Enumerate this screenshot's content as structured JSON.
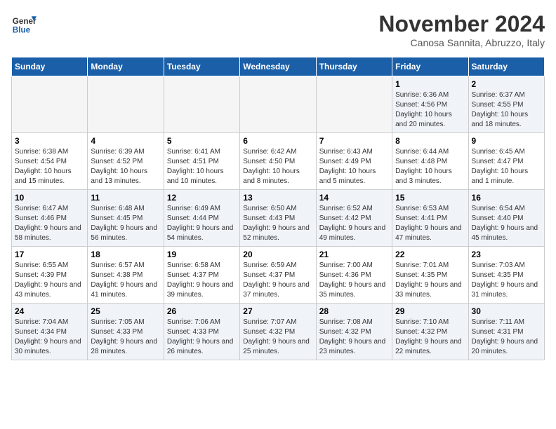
{
  "header": {
    "logo_line1": "General",
    "logo_line2": "Blue",
    "month": "November 2024",
    "location": "Canosa Sannita, Abruzzo, Italy"
  },
  "weekdays": [
    "Sunday",
    "Monday",
    "Tuesday",
    "Wednesday",
    "Thursday",
    "Friday",
    "Saturday"
  ],
  "weeks": [
    [
      {
        "day": "",
        "info": ""
      },
      {
        "day": "",
        "info": ""
      },
      {
        "day": "",
        "info": ""
      },
      {
        "day": "",
        "info": ""
      },
      {
        "day": "",
        "info": ""
      },
      {
        "day": "1",
        "info": "Sunrise: 6:36 AM\nSunset: 4:56 PM\nDaylight: 10 hours and 20 minutes."
      },
      {
        "day": "2",
        "info": "Sunrise: 6:37 AM\nSunset: 4:55 PM\nDaylight: 10 hours and 18 minutes."
      }
    ],
    [
      {
        "day": "3",
        "info": "Sunrise: 6:38 AM\nSunset: 4:54 PM\nDaylight: 10 hours and 15 minutes."
      },
      {
        "day": "4",
        "info": "Sunrise: 6:39 AM\nSunset: 4:52 PM\nDaylight: 10 hours and 13 minutes."
      },
      {
        "day": "5",
        "info": "Sunrise: 6:41 AM\nSunset: 4:51 PM\nDaylight: 10 hours and 10 minutes."
      },
      {
        "day": "6",
        "info": "Sunrise: 6:42 AM\nSunset: 4:50 PM\nDaylight: 10 hours and 8 minutes."
      },
      {
        "day": "7",
        "info": "Sunrise: 6:43 AM\nSunset: 4:49 PM\nDaylight: 10 hours and 5 minutes."
      },
      {
        "day": "8",
        "info": "Sunrise: 6:44 AM\nSunset: 4:48 PM\nDaylight: 10 hours and 3 minutes."
      },
      {
        "day": "9",
        "info": "Sunrise: 6:45 AM\nSunset: 4:47 PM\nDaylight: 10 hours and 1 minute."
      }
    ],
    [
      {
        "day": "10",
        "info": "Sunrise: 6:47 AM\nSunset: 4:46 PM\nDaylight: 9 hours and 58 minutes."
      },
      {
        "day": "11",
        "info": "Sunrise: 6:48 AM\nSunset: 4:45 PM\nDaylight: 9 hours and 56 minutes."
      },
      {
        "day": "12",
        "info": "Sunrise: 6:49 AM\nSunset: 4:44 PM\nDaylight: 9 hours and 54 minutes."
      },
      {
        "day": "13",
        "info": "Sunrise: 6:50 AM\nSunset: 4:43 PM\nDaylight: 9 hours and 52 minutes."
      },
      {
        "day": "14",
        "info": "Sunrise: 6:52 AM\nSunset: 4:42 PM\nDaylight: 9 hours and 49 minutes."
      },
      {
        "day": "15",
        "info": "Sunrise: 6:53 AM\nSunset: 4:41 PM\nDaylight: 9 hours and 47 minutes."
      },
      {
        "day": "16",
        "info": "Sunrise: 6:54 AM\nSunset: 4:40 PM\nDaylight: 9 hours and 45 minutes."
      }
    ],
    [
      {
        "day": "17",
        "info": "Sunrise: 6:55 AM\nSunset: 4:39 PM\nDaylight: 9 hours and 43 minutes."
      },
      {
        "day": "18",
        "info": "Sunrise: 6:57 AM\nSunset: 4:38 PM\nDaylight: 9 hours and 41 minutes."
      },
      {
        "day": "19",
        "info": "Sunrise: 6:58 AM\nSunset: 4:37 PM\nDaylight: 9 hours and 39 minutes."
      },
      {
        "day": "20",
        "info": "Sunrise: 6:59 AM\nSunset: 4:37 PM\nDaylight: 9 hours and 37 minutes."
      },
      {
        "day": "21",
        "info": "Sunrise: 7:00 AM\nSunset: 4:36 PM\nDaylight: 9 hours and 35 minutes."
      },
      {
        "day": "22",
        "info": "Sunrise: 7:01 AM\nSunset: 4:35 PM\nDaylight: 9 hours and 33 minutes."
      },
      {
        "day": "23",
        "info": "Sunrise: 7:03 AM\nSunset: 4:35 PM\nDaylight: 9 hours and 31 minutes."
      }
    ],
    [
      {
        "day": "24",
        "info": "Sunrise: 7:04 AM\nSunset: 4:34 PM\nDaylight: 9 hours and 30 minutes."
      },
      {
        "day": "25",
        "info": "Sunrise: 7:05 AM\nSunset: 4:33 PM\nDaylight: 9 hours and 28 minutes."
      },
      {
        "day": "26",
        "info": "Sunrise: 7:06 AM\nSunset: 4:33 PM\nDaylight: 9 hours and 26 minutes."
      },
      {
        "day": "27",
        "info": "Sunrise: 7:07 AM\nSunset: 4:32 PM\nDaylight: 9 hours and 25 minutes."
      },
      {
        "day": "28",
        "info": "Sunrise: 7:08 AM\nSunset: 4:32 PM\nDaylight: 9 hours and 23 minutes."
      },
      {
        "day": "29",
        "info": "Sunrise: 7:10 AM\nSunset: 4:32 PM\nDaylight: 9 hours and 22 minutes."
      },
      {
        "day": "30",
        "info": "Sunrise: 7:11 AM\nSunset: 4:31 PM\nDaylight: 9 hours and 20 minutes."
      }
    ]
  ]
}
